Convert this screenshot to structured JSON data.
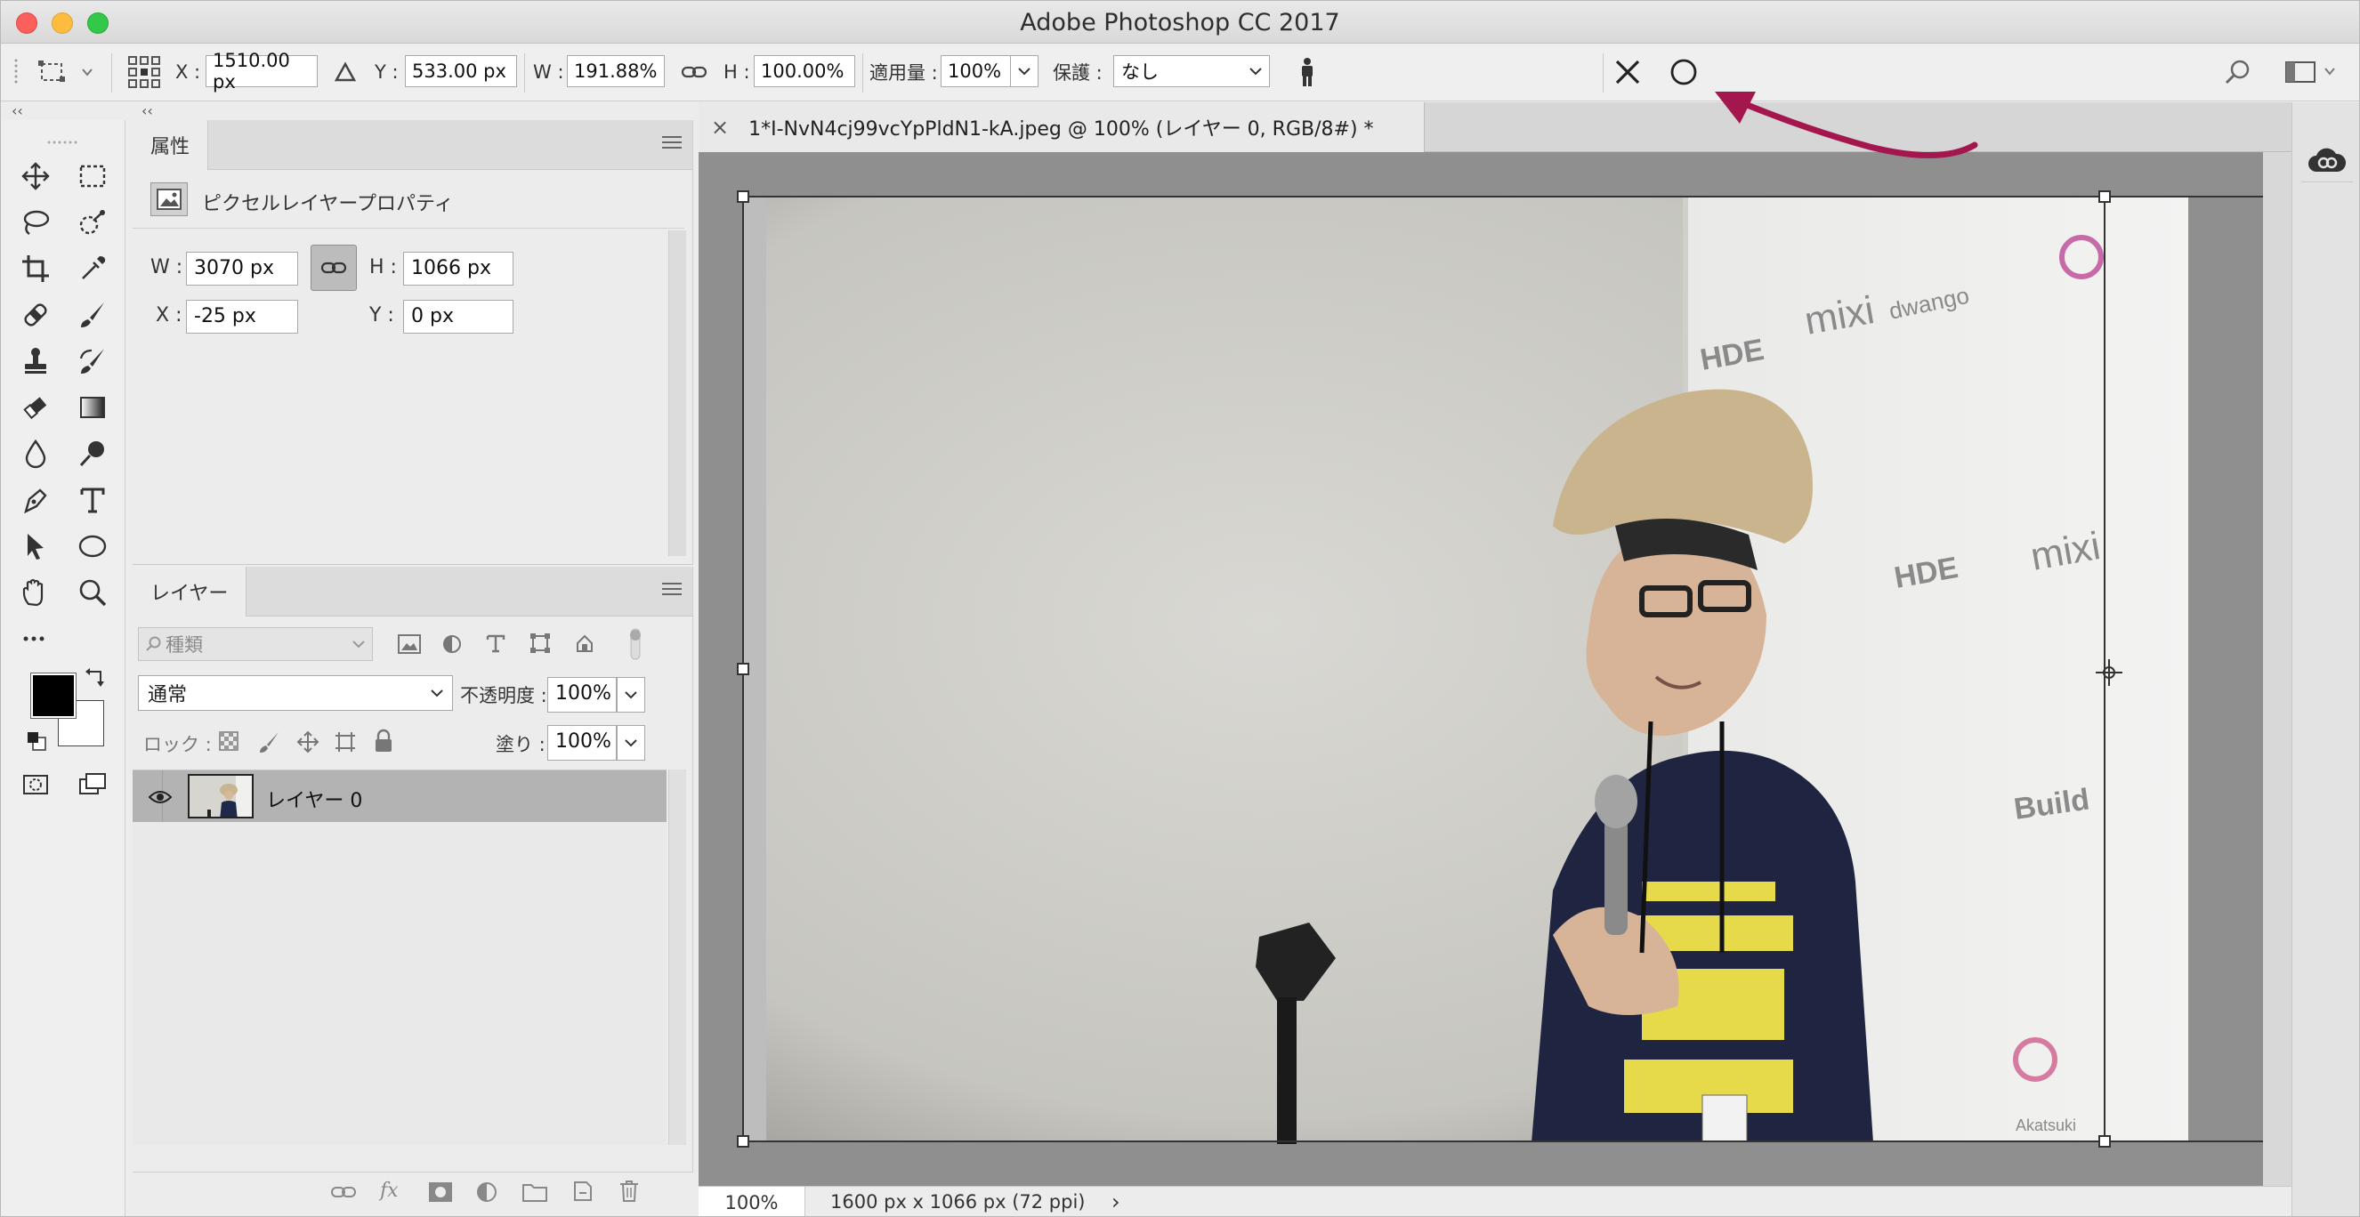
{
  "window": {
    "title": "Adobe Photoshop CC 2017"
  },
  "options_bar": {
    "x_label": "X :",
    "x_value": "1510.00 px",
    "y_label": "Y :",
    "y_value": "533.00 px",
    "w_label": "W :",
    "w_value": "191.88%",
    "h_label": "H :",
    "h_value": "100.00%",
    "amount_label": "適用量 :",
    "amount_value": "100%",
    "protect_label": "保護 :",
    "protect_value": "なし"
  },
  "collapse_glyph": "‹‹",
  "properties_panel": {
    "tab_label": "属性",
    "subtitle": "ピクセルレイヤープロパティ",
    "w_label": "W :",
    "w_value": "3070 px",
    "h_label": "H :",
    "h_value": "1066 px",
    "x_label": "X :",
    "x_value": "-25 px",
    "y_label": "Y :",
    "y_value": "0 px"
  },
  "layers_panel": {
    "tab_label": "レイヤー",
    "filter_placeholder": "種類",
    "blend_mode": "通常",
    "opacity_label": "不透明度 :",
    "opacity_value": "100%",
    "lock_label": "ロック :",
    "fill_label": "塗り :",
    "fill_value": "100%",
    "layers": [
      {
        "name": "レイヤー 0",
        "visible": true,
        "selected": true
      }
    ]
  },
  "document": {
    "tab_title": "1*I-NvN4cj99vcYpPldN1-kA.jpeg @ 100% (レイヤー 0, RGB/8#) *",
    "close_glyph": "×"
  },
  "status_bar": {
    "zoom": "100%",
    "doc_info": "1600 px x 1066 px (72 ppi)",
    "arrow_glyph": "›"
  },
  "colors": {
    "annotation_arrow": "#a3164e",
    "foreground": "#000000",
    "background": "#ffffff"
  }
}
